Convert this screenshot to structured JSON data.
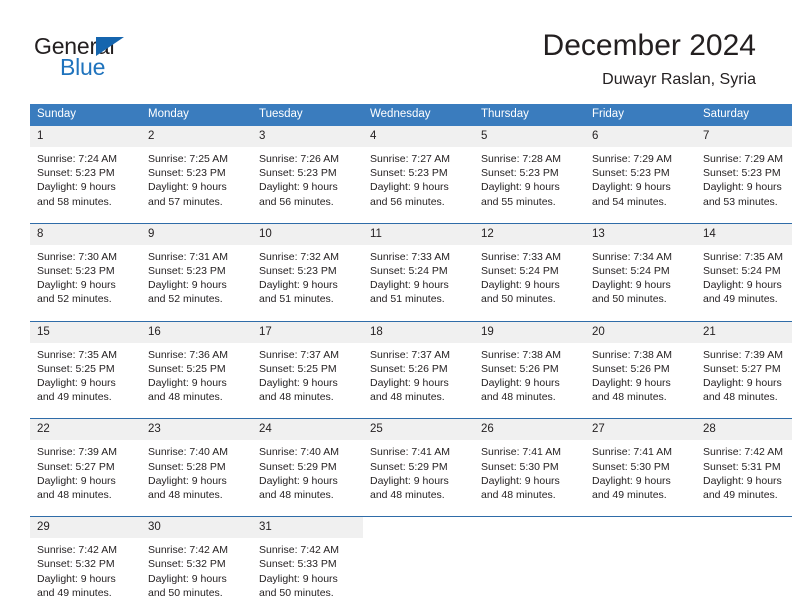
{
  "logo": {
    "word_one": "General",
    "word_two": "Blue",
    "triangle_color": "#1565ae"
  },
  "header": {
    "title": "December 2024",
    "subtitle": "Duwayr Raslan, Syria"
  },
  "theme": {
    "header_bg": "#3a7cbe",
    "daynum_bg": "#f0f0f0",
    "rule_color": "#2f6ca8",
    "text_color": "#231f20"
  },
  "weekday_headers": [
    "Sunday",
    "Monday",
    "Tuesday",
    "Wednesday",
    "Thursday",
    "Friday",
    "Saturday"
  ],
  "weeks": [
    [
      {
        "day": "1",
        "sunrise": "Sunrise: 7:24 AM",
        "sunset": "Sunset: 5:23 PM",
        "daylight_1": "Daylight: 9 hours",
        "daylight_2": "and 58 minutes."
      },
      {
        "day": "2",
        "sunrise": "Sunrise: 7:25 AM",
        "sunset": "Sunset: 5:23 PM",
        "daylight_1": "Daylight: 9 hours",
        "daylight_2": "and 57 minutes."
      },
      {
        "day": "3",
        "sunrise": "Sunrise: 7:26 AM",
        "sunset": "Sunset: 5:23 PM",
        "daylight_1": "Daylight: 9 hours",
        "daylight_2": "and 56 minutes."
      },
      {
        "day": "4",
        "sunrise": "Sunrise: 7:27 AM",
        "sunset": "Sunset: 5:23 PM",
        "daylight_1": "Daylight: 9 hours",
        "daylight_2": "and 56 minutes."
      },
      {
        "day": "5",
        "sunrise": "Sunrise: 7:28 AM",
        "sunset": "Sunset: 5:23 PM",
        "daylight_1": "Daylight: 9 hours",
        "daylight_2": "and 55 minutes."
      },
      {
        "day": "6",
        "sunrise": "Sunrise: 7:29 AM",
        "sunset": "Sunset: 5:23 PM",
        "daylight_1": "Daylight: 9 hours",
        "daylight_2": "and 54 minutes."
      },
      {
        "day": "7",
        "sunrise": "Sunrise: 7:29 AM",
        "sunset": "Sunset: 5:23 PM",
        "daylight_1": "Daylight: 9 hours",
        "daylight_2": "and 53 minutes."
      }
    ],
    [
      {
        "day": "8",
        "sunrise": "Sunrise: 7:30 AM",
        "sunset": "Sunset: 5:23 PM",
        "daylight_1": "Daylight: 9 hours",
        "daylight_2": "and 52 minutes."
      },
      {
        "day": "9",
        "sunrise": "Sunrise: 7:31 AM",
        "sunset": "Sunset: 5:23 PM",
        "daylight_1": "Daylight: 9 hours",
        "daylight_2": "and 52 minutes."
      },
      {
        "day": "10",
        "sunrise": "Sunrise: 7:32 AM",
        "sunset": "Sunset: 5:23 PM",
        "daylight_1": "Daylight: 9 hours",
        "daylight_2": "and 51 minutes."
      },
      {
        "day": "11",
        "sunrise": "Sunrise: 7:33 AM",
        "sunset": "Sunset: 5:24 PM",
        "daylight_1": "Daylight: 9 hours",
        "daylight_2": "and 51 minutes."
      },
      {
        "day": "12",
        "sunrise": "Sunrise: 7:33 AM",
        "sunset": "Sunset: 5:24 PM",
        "daylight_1": "Daylight: 9 hours",
        "daylight_2": "and 50 minutes."
      },
      {
        "day": "13",
        "sunrise": "Sunrise: 7:34 AM",
        "sunset": "Sunset: 5:24 PM",
        "daylight_1": "Daylight: 9 hours",
        "daylight_2": "and 50 minutes."
      },
      {
        "day": "14",
        "sunrise": "Sunrise: 7:35 AM",
        "sunset": "Sunset: 5:24 PM",
        "daylight_1": "Daylight: 9 hours",
        "daylight_2": "and 49 minutes."
      }
    ],
    [
      {
        "day": "15",
        "sunrise": "Sunrise: 7:35 AM",
        "sunset": "Sunset: 5:25 PM",
        "daylight_1": "Daylight: 9 hours",
        "daylight_2": "and 49 minutes."
      },
      {
        "day": "16",
        "sunrise": "Sunrise: 7:36 AM",
        "sunset": "Sunset: 5:25 PM",
        "daylight_1": "Daylight: 9 hours",
        "daylight_2": "and 48 minutes."
      },
      {
        "day": "17",
        "sunrise": "Sunrise: 7:37 AM",
        "sunset": "Sunset: 5:25 PM",
        "daylight_1": "Daylight: 9 hours",
        "daylight_2": "and 48 minutes."
      },
      {
        "day": "18",
        "sunrise": "Sunrise: 7:37 AM",
        "sunset": "Sunset: 5:26 PM",
        "daylight_1": "Daylight: 9 hours",
        "daylight_2": "and 48 minutes."
      },
      {
        "day": "19",
        "sunrise": "Sunrise: 7:38 AM",
        "sunset": "Sunset: 5:26 PM",
        "daylight_1": "Daylight: 9 hours",
        "daylight_2": "and 48 minutes."
      },
      {
        "day": "20",
        "sunrise": "Sunrise: 7:38 AM",
        "sunset": "Sunset: 5:26 PM",
        "daylight_1": "Daylight: 9 hours",
        "daylight_2": "and 48 minutes."
      },
      {
        "day": "21",
        "sunrise": "Sunrise: 7:39 AM",
        "sunset": "Sunset: 5:27 PM",
        "daylight_1": "Daylight: 9 hours",
        "daylight_2": "and 48 minutes."
      }
    ],
    [
      {
        "day": "22",
        "sunrise": "Sunrise: 7:39 AM",
        "sunset": "Sunset: 5:27 PM",
        "daylight_1": "Daylight: 9 hours",
        "daylight_2": "and 48 minutes."
      },
      {
        "day": "23",
        "sunrise": "Sunrise: 7:40 AM",
        "sunset": "Sunset: 5:28 PM",
        "daylight_1": "Daylight: 9 hours",
        "daylight_2": "and 48 minutes."
      },
      {
        "day": "24",
        "sunrise": "Sunrise: 7:40 AM",
        "sunset": "Sunset: 5:29 PM",
        "daylight_1": "Daylight: 9 hours",
        "daylight_2": "and 48 minutes."
      },
      {
        "day": "25",
        "sunrise": "Sunrise: 7:41 AM",
        "sunset": "Sunset: 5:29 PM",
        "daylight_1": "Daylight: 9 hours",
        "daylight_2": "and 48 minutes."
      },
      {
        "day": "26",
        "sunrise": "Sunrise: 7:41 AM",
        "sunset": "Sunset: 5:30 PM",
        "daylight_1": "Daylight: 9 hours",
        "daylight_2": "and 48 minutes."
      },
      {
        "day": "27",
        "sunrise": "Sunrise: 7:41 AM",
        "sunset": "Sunset: 5:30 PM",
        "daylight_1": "Daylight: 9 hours",
        "daylight_2": "and 49 minutes."
      },
      {
        "day": "28",
        "sunrise": "Sunrise: 7:42 AM",
        "sunset": "Sunset: 5:31 PM",
        "daylight_1": "Daylight: 9 hours",
        "daylight_2": "and 49 minutes."
      }
    ],
    [
      {
        "day": "29",
        "sunrise": "Sunrise: 7:42 AM",
        "sunset": "Sunset: 5:32 PM",
        "daylight_1": "Daylight: 9 hours",
        "daylight_2": "and 49 minutes."
      },
      {
        "day": "30",
        "sunrise": "Sunrise: 7:42 AM",
        "sunset": "Sunset: 5:32 PM",
        "daylight_1": "Daylight: 9 hours",
        "daylight_2": "and 50 minutes."
      },
      {
        "day": "31",
        "sunrise": "Sunrise: 7:42 AM",
        "sunset": "Sunset: 5:33 PM",
        "daylight_1": "Daylight: 9 hours",
        "daylight_2": "and 50 minutes."
      },
      {
        "day": "",
        "sunrise": "",
        "sunset": "",
        "daylight_1": "",
        "daylight_2": ""
      },
      {
        "day": "",
        "sunrise": "",
        "sunset": "",
        "daylight_1": "",
        "daylight_2": ""
      },
      {
        "day": "",
        "sunrise": "",
        "sunset": "",
        "daylight_1": "",
        "daylight_2": ""
      },
      {
        "day": "",
        "sunrise": "",
        "sunset": "",
        "daylight_1": "",
        "daylight_2": ""
      }
    ]
  ]
}
